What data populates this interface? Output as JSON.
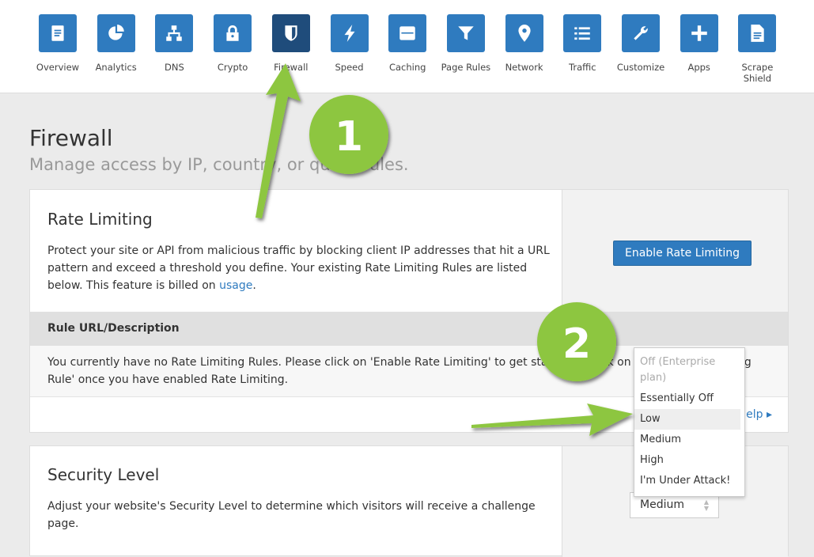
{
  "nav": [
    {
      "label": "Overview",
      "icon": "clipboard-icon"
    },
    {
      "label": "Analytics",
      "icon": "pie-chart-icon"
    },
    {
      "label": "DNS",
      "icon": "sitemap-icon"
    },
    {
      "label": "Crypto",
      "icon": "lock-icon"
    },
    {
      "label": "Firewall",
      "icon": "shield-icon",
      "active": true
    },
    {
      "label": "Speed",
      "icon": "lightning-icon"
    },
    {
      "label": "Caching",
      "icon": "server-icon"
    },
    {
      "label": "Page Rules",
      "icon": "filter-icon"
    },
    {
      "label": "Network",
      "icon": "map-pin-icon"
    },
    {
      "label": "Traffic",
      "icon": "list-icon"
    },
    {
      "label": "Customize",
      "icon": "wrench-icon"
    },
    {
      "label": "Apps",
      "icon": "plus-icon"
    },
    {
      "label": "Scrape Shield",
      "icon": "document-icon"
    }
  ],
  "page": {
    "title": "Firewall",
    "subtitle": "Manage access by IP, country, or query rules."
  },
  "rate_limiting": {
    "title": "Rate Limiting",
    "desc_before": "Protect your site or API from malicious traffic by blocking client IP addresses that hit a URL pattern and exceed a threshold you define. Your existing Rate Limiting Rules are listed below. This feature is billed on ",
    "desc_link": "usage",
    "desc_after": ".",
    "button": "Enable Rate Limiting",
    "table_header": "Rule URL/Description",
    "empty_message": "You currently have no Rate Limiting Rules. Please click on 'Enable Rate Limiting' to get started or click on 'Create Rate Limiting Rule' once you have enabled Rate Limiting.",
    "help": "Help ▸"
  },
  "security_level": {
    "title": "Security Level",
    "desc": "Adjust your website's Security Level to determine which visitors will receive a challenge page.",
    "selected": "Medium",
    "options": [
      {
        "label": "Off (Enterprise plan)",
        "disabled": true
      },
      {
        "label": "Essentially Off"
      },
      {
        "label": "Low",
        "highlighted": true
      },
      {
        "label": "Medium"
      },
      {
        "label": "High"
      },
      {
        "label": "I'm Under Attack!"
      }
    ]
  },
  "annotations": {
    "step1": "1",
    "step2": "2",
    "color": "#8dc63f"
  },
  "colors": {
    "primary": "#2f7bbf",
    "active": "#1f4c7b"
  }
}
